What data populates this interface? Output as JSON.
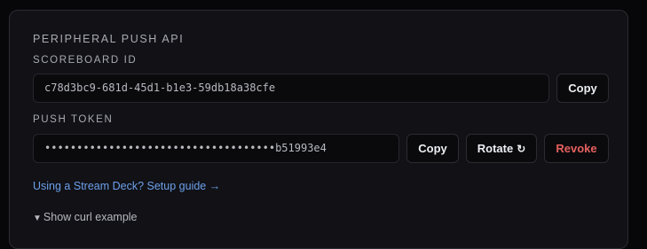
{
  "card": {
    "title": "PERIPHERAL PUSH API",
    "scoreboard": {
      "label": "SCOREBOARD ID",
      "value": "c78d3bc9-681d-45d1-b1e3-59db18a38cfe",
      "copy_label": "Copy"
    },
    "token": {
      "label": "PUSH TOKEN",
      "value": "••••••••••••••••••••••••••••••••••••b51993e4",
      "copy_label": "Copy",
      "rotate_label": "Rotate",
      "rotate_icon": "↻",
      "revoke_label": "Revoke"
    },
    "guide_link": "Using a Stream Deck? Setup guide →",
    "curl_toggle": {
      "caret": "▼",
      "label": "Show curl example"
    }
  },
  "colors": {
    "accent_link": "#6da0ea",
    "danger": "#e5605e"
  }
}
